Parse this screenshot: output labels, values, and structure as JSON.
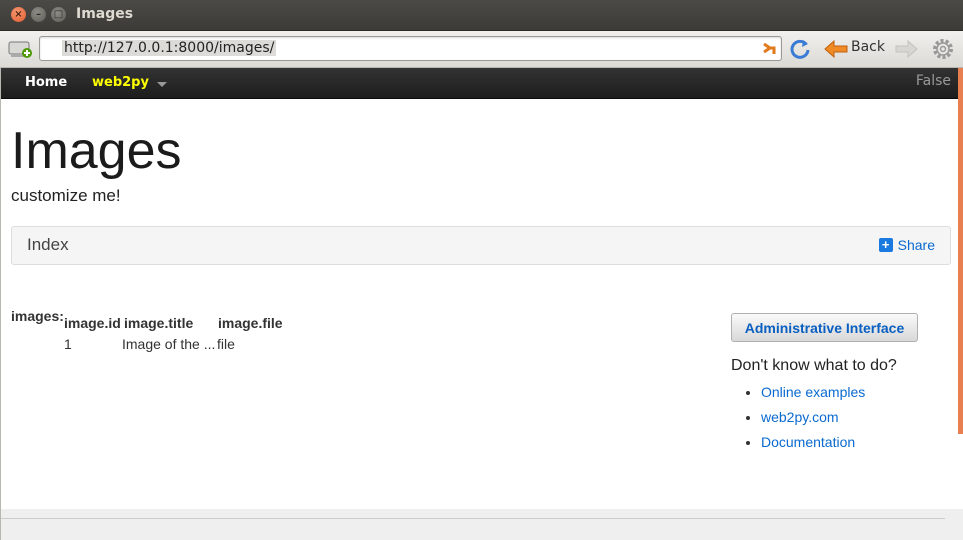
{
  "window": {
    "title": "Images"
  },
  "browser": {
    "url": "http://127.0.0.1:8000/images/",
    "back_label": "Back"
  },
  "navbar": {
    "home": "Home",
    "brand": "web2py",
    "right_text": "False"
  },
  "page": {
    "title": "Images",
    "subtitle": "customize me!",
    "breadcrumb": "Index",
    "share": "Share"
  },
  "table": {
    "label": "images:",
    "headers": [
      "image.id",
      "image.title",
      "image.file"
    ],
    "rows": [
      [
        "1",
        "Image of the ...",
        "file"
      ]
    ]
  },
  "sidebar": {
    "admin_button": "Administrative Interface",
    "help_text": "Don't know what to do?",
    "links": [
      "Online examples",
      "web2py.com",
      "Documentation"
    ]
  }
}
